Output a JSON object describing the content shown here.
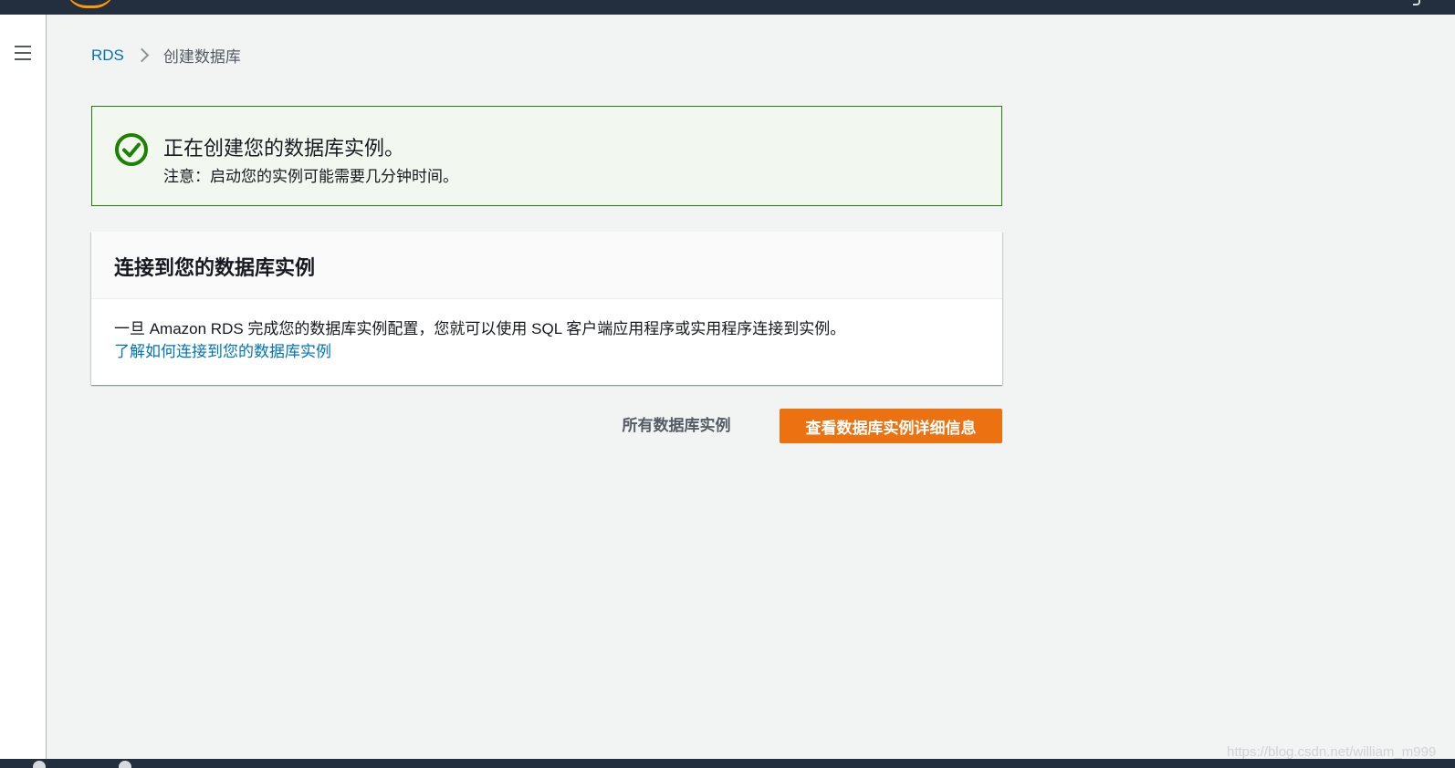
{
  "breadcrumb": {
    "root": "RDS",
    "current": "创建数据库"
  },
  "flash": {
    "title": "正在创建您的数据库实例。",
    "note": "注意：启动您的实例可能需要几分钟时间。",
    "status_color": "#1d8102"
  },
  "connect_panel": {
    "title": "连接到您的数据库实例",
    "description": "一旦 Amazon RDS 完成您的数据库实例配置，您就可以使用 SQL 客户端应用程序或实用程序连接到实例。",
    "learn_link": "了解如何连接到您的数据库实例"
  },
  "actions": {
    "all_instances_label": "所有数据库实例",
    "view_details_label": "查看数据库实例详细信息",
    "primary_color": "#ec7211"
  },
  "watermark": "https://blog.csdn.net/william_m999"
}
